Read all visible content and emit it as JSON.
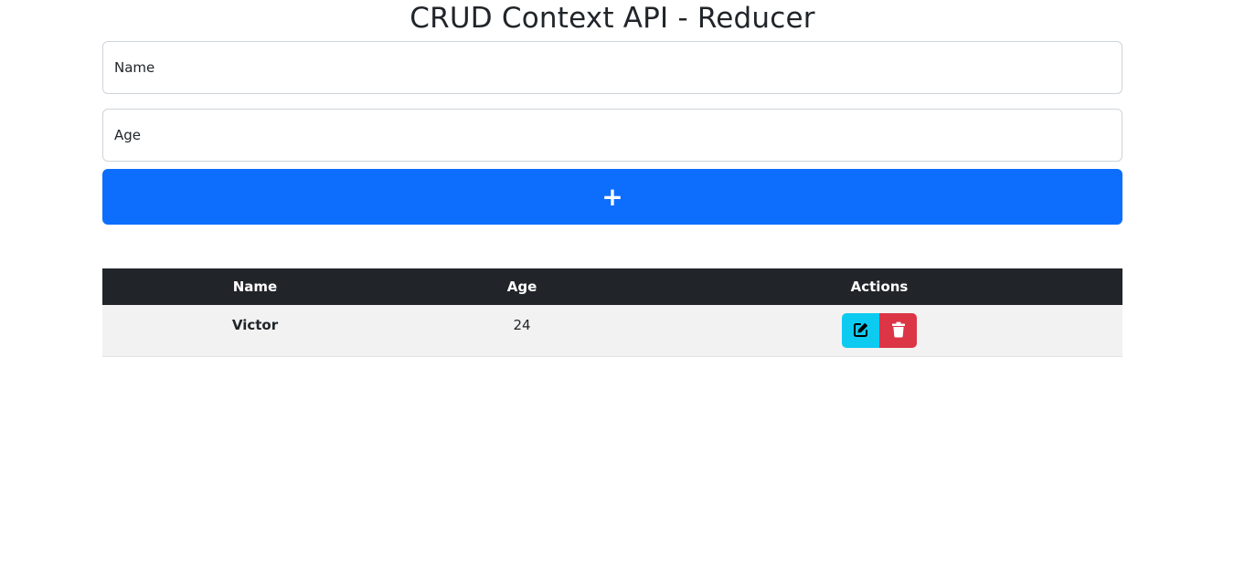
{
  "title": "CRUD Context API - Reducer",
  "form": {
    "name_placeholder": "Name",
    "age_placeholder": "Age",
    "add_label": "+"
  },
  "table": {
    "columns": [
      "Name",
      "Age",
      "Actions"
    ],
    "rows": [
      {
        "name": "Victor",
        "age": "24"
      }
    ]
  },
  "icons": {
    "edit": "edit-icon",
    "delete": "trash-icon"
  },
  "colors": {
    "primary": "#0d6efd",
    "info": "#0dcaf0",
    "danger": "#dc3545",
    "header_dark": "#212529"
  }
}
